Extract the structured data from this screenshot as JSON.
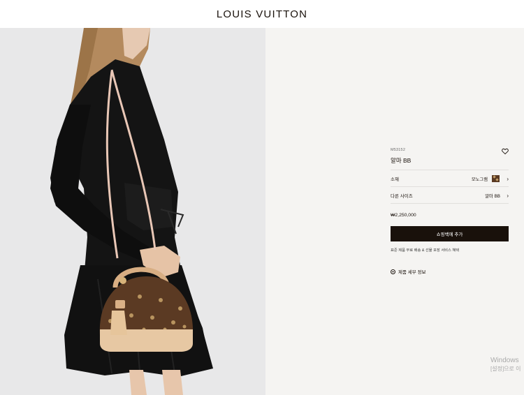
{
  "header": {
    "brand": "LOUIS VUITTON"
  },
  "product": {
    "sku": "M53152",
    "name": "알마 BB",
    "material": {
      "label": "소재",
      "value": "모노그램",
      "swatch_color": "#5a3a22"
    },
    "sizes": {
      "label": "다른 사이즈",
      "value": "알마 BB"
    },
    "price": "₩2,250,000",
    "add_to_bag": "쇼핑백에 추가",
    "shipping_note": "표준 제품 무료 배송 & 선물 포장 서비스 혜택",
    "details_link": "제품 세부 정보"
  },
  "icons": {
    "wishlist": "heart-icon",
    "chevron": "chevron-right-icon",
    "details": "minus-circle-icon"
  },
  "watermark": {
    "line1": "Windows",
    "line2": "[설정]으로 이"
  },
  "colors": {
    "brand_dark": "#19110b",
    "panel_bg": "#f5f4f2",
    "photo_bg": "#e9e9ea"
  }
}
